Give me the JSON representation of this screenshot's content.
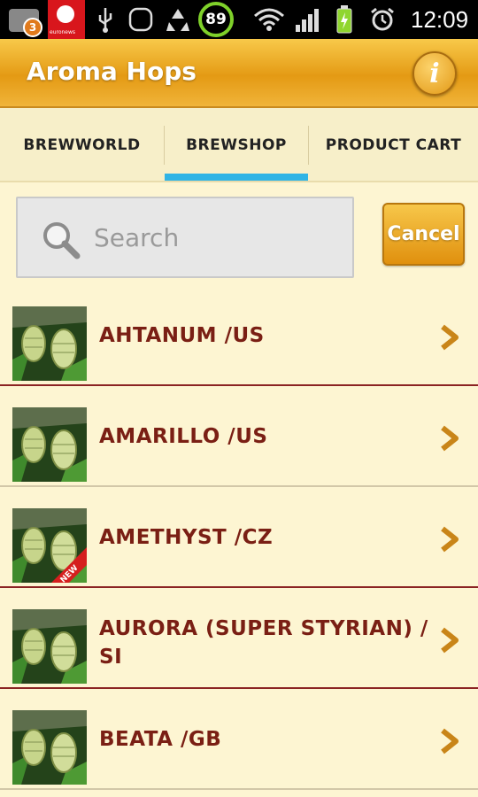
{
  "status_bar": {
    "notification_count": "3",
    "carrier_text": "euronews",
    "battery_percent": "89",
    "time": "12:09"
  },
  "header": {
    "title": "Aroma Hops",
    "info_label": "i"
  },
  "tabs": [
    {
      "label": "BREWWORLD",
      "active": false
    },
    {
      "label": "BREWSHOP",
      "active": true
    },
    {
      "label": "PRODUCT CART",
      "active": false
    }
  ],
  "search": {
    "placeholder": "Search",
    "cancel_label": "Cancel"
  },
  "products": [
    {
      "name": "AHTANUM /US",
      "badge": ""
    },
    {
      "name": "AMARILLO /US",
      "badge": ""
    },
    {
      "name": "AMETHYST /CZ",
      "badge": "NEW"
    },
    {
      "name": "AURORA (SUPER STYRIAN) /",
      "name_line2": "SI",
      "badge": ""
    },
    {
      "name": "BEATA /GB",
      "badge": ""
    }
  ],
  "colors": {
    "accent_tab": "#30b4e5",
    "header_orange": "#e49a14",
    "item_text": "#7a1f14",
    "background": "#fdf5d2"
  }
}
